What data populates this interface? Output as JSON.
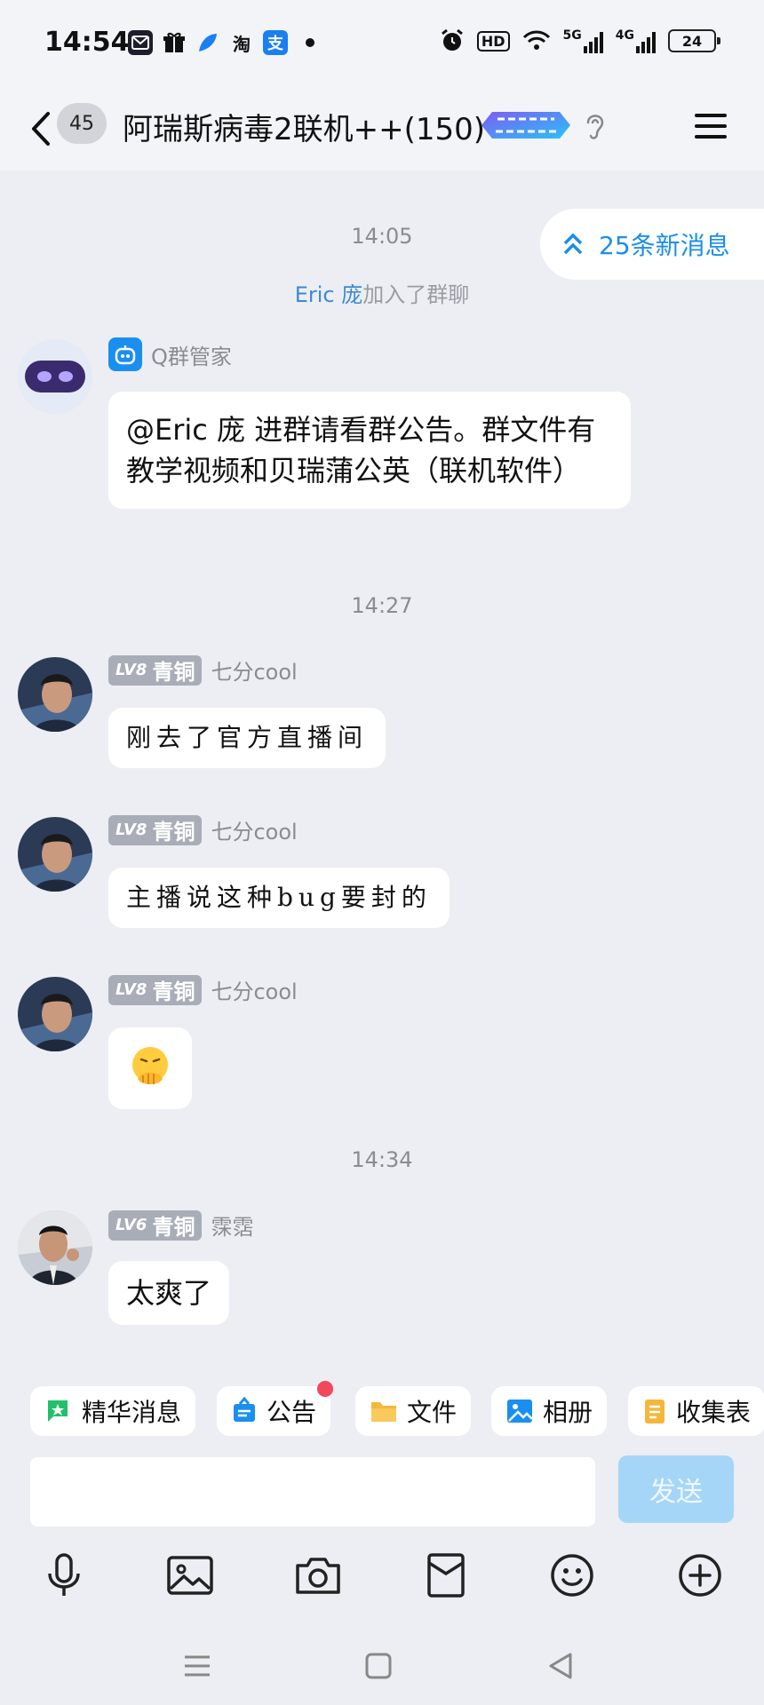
{
  "status_bar": {
    "time": "14:54",
    "app_icons": [
      "envelope-app-icon",
      "gift-app-icon",
      "feather-app-icon",
      "taobao-app-icon",
      "alipay-app-icon"
    ],
    "taobao_label": "淘",
    "alipay_label": "支",
    "hd_label": "HD",
    "net_5g": "5G",
    "net_4g": "4G",
    "battery": "24"
  },
  "header": {
    "unread_count": "45",
    "title": "阿瑞斯病毒2联机++(150)"
  },
  "new_messages": "25条新消息",
  "messages": [
    {
      "type": "time",
      "text": "14:05"
    },
    {
      "type": "system",
      "who": "Eric 庞",
      "action": "加入了群聊"
    },
    {
      "type": "bot",
      "sender": "Q群管家",
      "text": "@Eric 庞 进群请看群公告。群文件有教学视频和贝瑞蒲公英（联机软件）"
    },
    {
      "type": "time",
      "text": "14:27"
    },
    {
      "type": "user",
      "level": "LV8",
      "rank": "青铜",
      "sender": "七分cool",
      "text": "刚去了官方直播间"
    },
    {
      "type": "user",
      "level": "LV8",
      "rank": "青铜",
      "sender": "七分cool",
      "text": "主播说这种bug要封的"
    },
    {
      "type": "user",
      "level": "LV8",
      "rank": "青铜",
      "sender": "七分cool",
      "text": "🫢"
    },
    {
      "type": "time",
      "text": "14:34"
    },
    {
      "type": "user",
      "level": "LV6",
      "rank": "青铜",
      "sender": "霂霑",
      "text": "太爽了"
    }
  ],
  "quick_tags": [
    {
      "label": "精华消息",
      "icon": "highlight-flag-icon",
      "color": "#22c06a"
    },
    {
      "label": "公告",
      "icon": "announcement-icon",
      "color": "#1a8ff0",
      "has_dot": true
    },
    {
      "label": "文件",
      "icon": "folder-icon",
      "color": "#f5b73b"
    },
    {
      "label": "相册",
      "icon": "album-icon",
      "color": "#1a8ff0"
    },
    {
      "label": "收集表",
      "icon": "form-icon",
      "color": "#f5b73b"
    }
  ],
  "input": {
    "placeholder": "",
    "send_label": "发送"
  },
  "toolbar": [
    "microphone-icon",
    "image-icon",
    "camera-icon",
    "red-packet-icon",
    "emoji-icon",
    "plus-icon"
  ],
  "nav": [
    "menu-nav-icon",
    "home-nav-icon",
    "back-nav-icon"
  ],
  "colors": {
    "accent": "#1c8ee8",
    "background": "#eceef3",
    "send_disabled": "#a6d6f7"
  }
}
